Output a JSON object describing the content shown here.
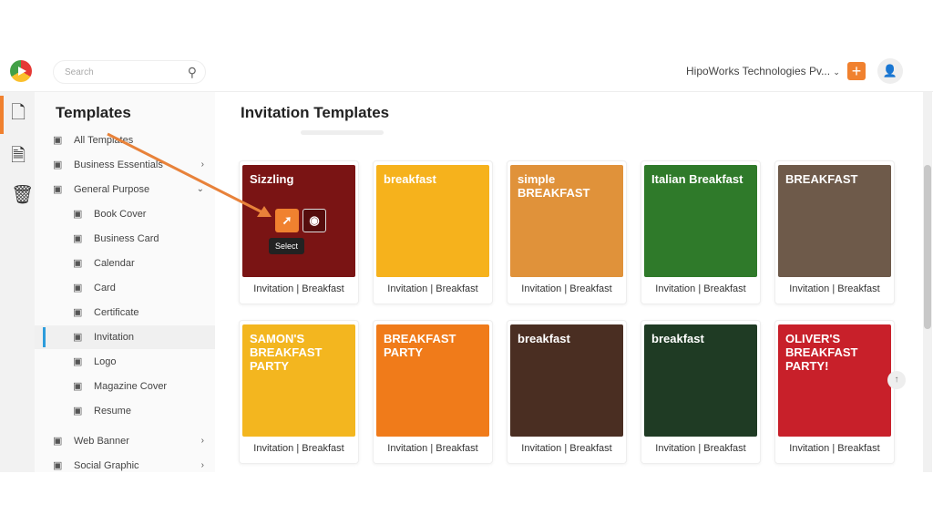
{
  "header": {
    "search_placeholder": "Search",
    "org_name": "HipoWorks Technologies Pv...",
    "add_label": "+"
  },
  "sidebar": {
    "title": "Templates",
    "items": [
      {
        "label": "All Templates",
        "icon": "grid-icon"
      },
      {
        "label": "Business Essentials",
        "icon": "building-icon",
        "chevron": "›"
      },
      {
        "label": "General Purpose",
        "icon": "list-icon",
        "chevron": "⌄"
      },
      {
        "label": "Book Cover",
        "icon": "book-icon"
      },
      {
        "label": "Business Card",
        "icon": "id-card-icon"
      },
      {
        "label": "Calendar",
        "icon": "calendar-icon"
      },
      {
        "label": "Card",
        "icon": "card-icon"
      },
      {
        "label": "Certificate",
        "icon": "award-icon"
      },
      {
        "label": "Invitation",
        "icon": "invitation-icon",
        "selected": true
      },
      {
        "label": "Logo",
        "icon": "heart-icon"
      },
      {
        "label": "Magazine Cover",
        "icon": "magazine-icon"
      },
      {
        "label": "Resume",
        "icon": "resume-icon"
      },
      {
        "label": "Web Banner",
        "icon": "banner-icon",
        "chevron": "›"
      },
      {
        "label": "Social Graphic",
        "icon": "social-icon",
        "chevron": "›"
      }
    ]
  },
  "main": {
    "title": "Invitation Templates",
    "hover_tooltip": "Select",
    "templates": [
      {
        "label": "Invitation | Breakfast",
        "thumb_text": "Sizzling",
        "bg": "#7a1414"
      },
      {
        "label": "Invitation | Breakfast",
        "thumb_text": "breakfast",
        "bg": "#f6b21c"
      },
      {
        "label": "Invitation | Breakfast",
        "thumb_text": "simple BREAKFAST",
        "bg": "#e0923a"
      },
      {
        "label": "Invitation | Breakfast",
        "thumb_text": "Italian Breakfast",
        "bg": "#2f7a2a"
      },
      {
        "label": "Invitation | Breakfast",
        "thumb_text": "BREAKFAST",
        "bg": "#6e5a4a"
      },
      {
        "label": "Invitation | Breakfast",
        "thumb_text": "SAMON'S BREAKFAST PARTY",
        "bg": "#f3b61f"
      },
      {
        "label": "Invitation | Breakfast",
        "thumb_text": "BREAKFAST PARTY",
        "bg": "#f07b1a"
      },
      {
        "label": "Invitation | Breakfast",
        "thumb_text": "breakfast",
        "bg": "#4a2e22"
      },
      {
        "label": "Invitation | Breakfast",
        "thumb_text": "breakfast",
        "bg": "#1f3b24"
      },
      {
        "label": "Invitation | Breakfast",
        "thumb_text": "OLIVER'S BREAKFAST PARTY!",
        "bg": "#c8202a"
      }
    ]
  },
  "colors": {
    "accent": "#f0812f",
    "selected_indicator": "#2d9cdb"
  }
}
